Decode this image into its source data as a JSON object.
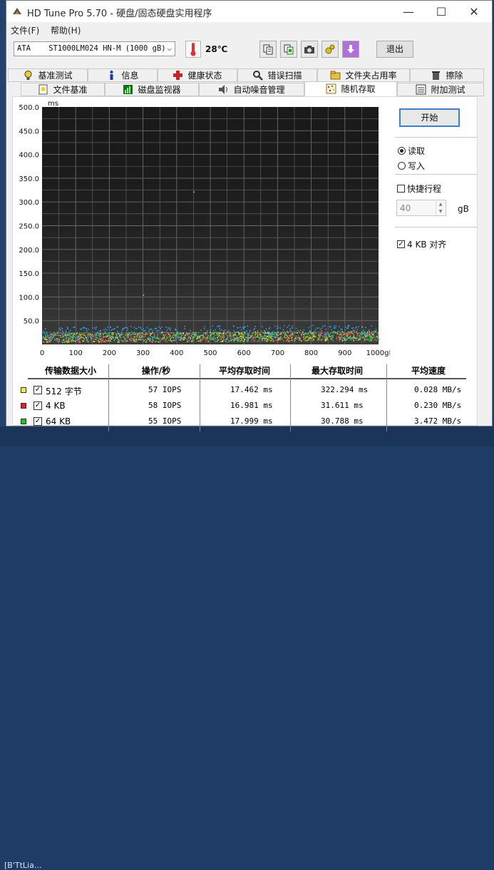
{
  "window": {
    "title": "HD Tune Pro 5.70 - 硬盘/固态硬盘实用程序",
    "controls": {
      "minimize": "—",
      "maximize": "☐",
      "close": "✕"
    }
  },
  "menu": {
    "file": "文件(F)",
    "help": "帮助(H)"
  },
  "toolbar": {
    "drive": "ATA    ST1000LM024 HN-M (1000 gB)",
    "temperature": "28℃",
    "exit_label": "退出",
    "icons": [
      "copy-text-icon",
      "copy-info-icon",
      "screenshot-icon",
      "options-icon",
      "save-icon"
    ]
  },
  "tabs": {
    "row1": [
      "基准测试",
      "信息",
      "健康状态",
      "错误扫描",
      "文件夹占用率",
      "擦除"
    ],
    "row2": [
      "文件基准",
      "磁盘监视器",
      "自动噪音管理",
      "随机存取",
      "附加测试"
    ],
    "active": "随机存取"
  },
  "controls": {
    "start_label": "开始",
    "read_label": "读取",
    "write_label": "写入",
    "mode": "read",
    "short_stroke_label": "快捷行程",
    "short_stroke_checked": false,
    "short_stroke_value": "40",
    "short_stroke_unit": "gB",
    "align_label": "4 KB 对齐",
    "align_checked": true
  },
  "chart_data": {
    "type": "scatter",
    "title": "",
    "xlabel": "",
    "ylabel": "ms",
    "x_unit": "gB",
    "xlim": [
      0,
      1000
    ],
    "ylim": [
      0,
      500
    ],
    "x_ticks": [
      "0",
      "100",
      "200",
      "300",
      "400",
      "500",
      "600",
      "700",
      "800",
      "900",
      "1000gB"
    ],
    "y_ticks": [
      "50.0",
      "100.0",
      "150.0",
      "200.0",
      "250.0",
      "300.0",
      "350.0",
      "400.0",
      "450.0",
      "500.0"
    ],
    "grid": true,
    "background": "#1a1a1a",
    "series": [
      {
        "name": "512 字节",
        "color": "#e8e840",
        "y_range": [
          5,
          25
        ]
      },
      {
        "name": "4 KB",
        "color": "#e83030",
        "y_range": [
          5,
          25
        ]
      },
      {
        "name": "64 KB",
        "color": "#30d040",
        "y_range": [
          5,
          25
        ]
      },
      {
        "name": "",
        "color": "#2f9be8",
        "y_range": [
          8,
          38
        ]
      }
    ]
  },
  "results": {
    "headers": [
      "传输数据大小",
      "操作/秒",
      "平均存取时间",
      "最大存取时间",
      "平均速度"
    ],
    "rows": [
      {
        "size": "512 字节",
        "color": "#f0f040",
        "ops": "57 IOPS",
        "avg": "17.462 ms",
        "max": "322.294 ms",
        "speed": "0.028 MB/s"
      },
      {
        "size": "4 KB",
        "color": "#e02020",
        "ops": "58 IOPS",
        "avg": "16.981 ms",
        "max": "31.611 ms",
        "speed": "0.230 MB/s"
      },
      {
        "size": "64 KB",
        "color": "#20c020",
        "ops": "55 IOPS",
        "avg": "17.999 ms",
        "max": "30.788 ms",
        "speed": "3.472 MB/s"
      }
    ]
  },
  "desktop": {
    "taskbar_text": "[B'TtLia..."
  }
}
